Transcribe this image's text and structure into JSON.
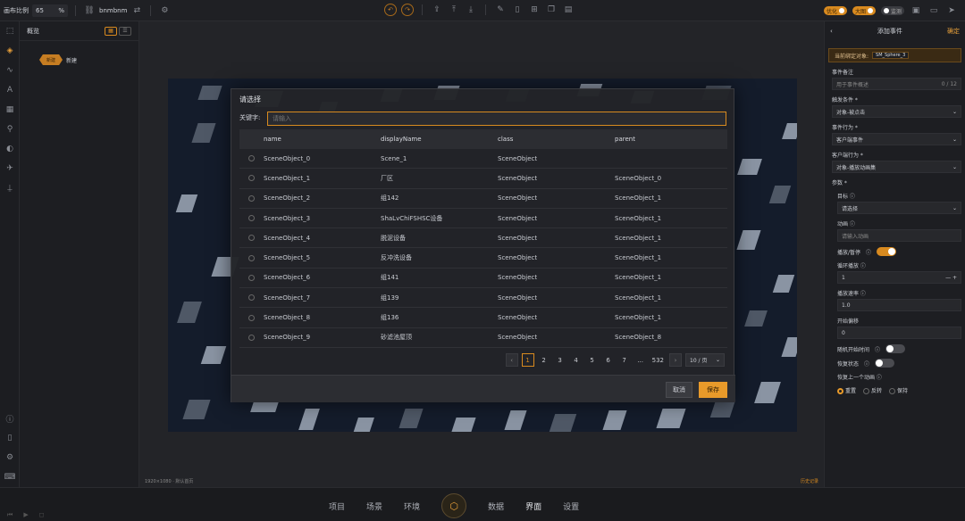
{
  "topbar": {
    "zoom_label": "画布比例",
    "zoom_value": "65",
    "zoom_unit": "%",
    "project": "bnmbnm",
    "toggle1": "优化",
    "toggle2": "大图",
    "toggle3": "监测"
  },
  "tree": {
    "title": "概览",
    "node_label": "新建",
    "node_text": "新建"
  },
  "dialog": {
    "title": "请选择",
    "keyword_label": "关键字:",
    "keyword_placeholder": "请输入",
    "columns": [
      "name",
      "displayName",
      "class",
      "parent"
    ],
    "rows": [
      {
        "name": "SceneObject_0",
        "display": "Scene_1",
        "cls": "SceneObject",
        "parent": ""
      },
      {
        "name": "SceneObject_1",
        "display": "厂区",
        "cls": "SceneObject",
        "parent": "SceneObject_0"
      },
      {
        "name": "SceneObject_2",
        "display": "组142",
        "cls": "SceneObject",
        "parent": "SceneObject_1"
      },
      {
        "name": "SceneObject_3",
        "display": "ShaLvChiFSHSC设备",
        "cls": "SceneObject",
        "parent": "SceneObject_1"
      },
      {
        "name": "SceneObject_4",
        "display": "脱泥设备",
        "cls": "SceneObject",
        "parent": "SceneObject_1"
      },
      {
        "name": "SceneObject_5",
        "display": "反冲洗设备",
        "cls": "SceneObject",
        "parent": "SceneObject_1"
      },
      {
        "name": "SceneObject_6",
        "display": "组141",
        "cls": "SceneObject",
        "parent": "SceneObject_1"
      },
      {
        "name": "SceneObject_7",
        "display": "组139",
        "cls": "SceneObject",
        "parent": "SceneObject_1"
      },
      {
        "name": "SceneObject_8",
        "display": "组136",
        "cls": "SceneObject",
        "parent": "SceneObject_1"
      },
      {
        "name": "SceneObject_9",
        "display": "砂滤池屋顶",
        "cls": "SceneObject",
        "parent": "SceneObject_8"
      }
    ],
    "pages": [
      "1",
      "2",
      "3",
      "4",
      "5",
      "6",
      "7",
      "...",
      "532"
    ],
    "page_size": "10 / 页",
    "cancel": "取消",
    "save": "保存"
  },
  "stage": {
    "size": "1920×1080",
    "default": "默认首页",
    "history": "历史记录"
  },
  "right": {
    "title": "添加事件",
    "confirm": "确定",
    "object_label": "当前绑定对象:",
    "object_value": "SM_Sphere_3",
    "note_label": "事件备注",
    "note_placeholder": "用于事件概述",
    "note_count": "0 / 12",
    "trigger_label": "触发条件 *",
    "trigger_value": "对象-被点击",
    "action_label": "事件行为 *",
    "action_value": "客户端事件",
    "client_label": "客户端行为 *",
    "client_value": "对象-播放动画集",
    "params_label": "参数 *",
    "target_label": "目标",
    "target_value": "请选择",
    "anim_label": "动画",
    "anim_placeholder": "请输入动画",
    "play_label": "播放/暂停",
    "loop_label": "循环播放",
    "loop_value": "1",
    "speed_label": "播放速率",
    "speed_value": "1.0",
    "offset_label": "开始偏移",
    "offset_value": "0",
    "random_label": "随机开始时间",
    "restore_label": "恢复状态",
    "restore_prev_label": "恢复上一个动画",
    "opt1": "重置",
    "opt2": "反转",
    "opt3": "保持"
  },
  "bottom": {
    "tabs": [
      "项目",
      "场景",
      "环境",
      "数据",
      "界面",
      "设置"
    ]
  }
}
